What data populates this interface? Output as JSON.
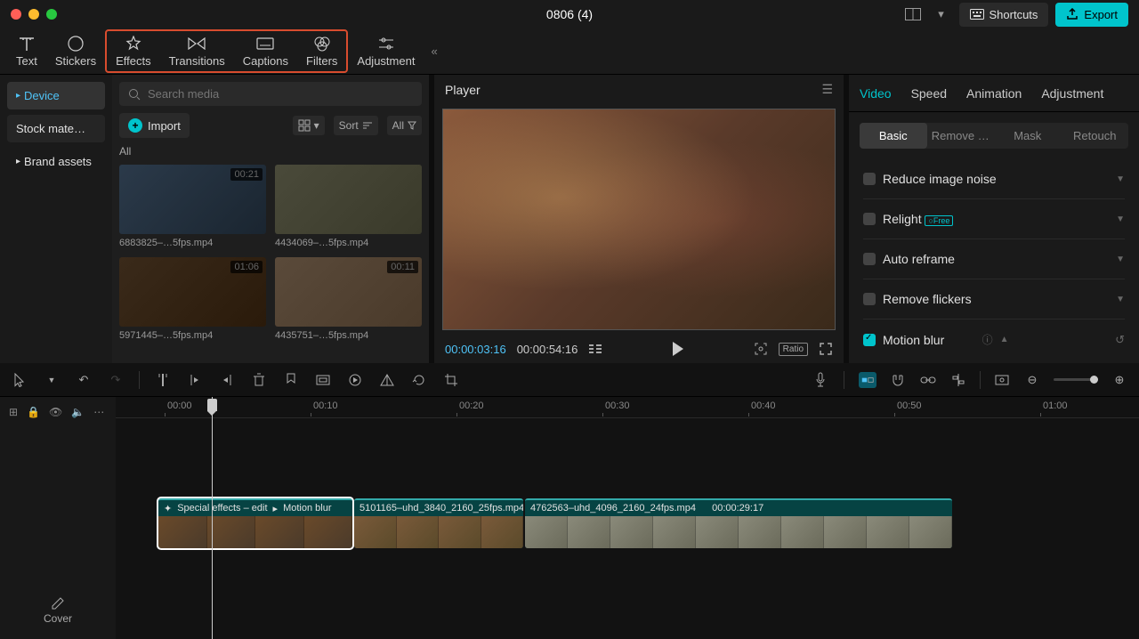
{
  "titlebar": {
    "title": "0806 (4)",
    "shortcuts": "Shortcuts",
    "export": "Export"
  },
  "topTabs": {
    "text": "Text",
    "stickers": "Stickers",
    "effects": "Effects",
    "transitions": "Transitions",
    "captions": "Captions",
    "filters": "Filters",
    "adjustment": "Adjustment"
  },
  "sidebar": {
    "device": "Device",
    "stock": "Stock mate…",
    "brand": "Brand assets"
  },
  "media": {
    "search_placeholder": "Search media",
    "import": "Import",
    "sort": "Sort",
    "all": "All",
    "section": "All",
    "items": [
      {
        "name": "6883825–…5fps.mp4",
        "duration": "00:21"
      },
      {
        "name": "4434069–…5fps.mp4",
        "duration": ""
      },
      {
        "name": "5971445–…5fps.mp4",
        "duration": "01:06"
      },
      {
        "name": "4435751–…5fps.mp4",
        "duration": "00:11"
      }
    ]
  },
  "player": {
    "title": "Player",
    "current": "00:00:03:16",
    "total": "00:00:54:16",
    "ratio": "Ratio"
  },
  "rightPanel": {
    "tabs": {
      "video": "Video",
      "speed": "Speed",
      "animation": "Animation",
      "adjustment": "Adjustment"
    },
    "subtabs": {
      "basic": "Basic",
      "remove": "Remove …",
      "mask": "Mask",
      "retouch": "Retouch"
    },
    "props": {
      "noise": "Reduce image noise",
      "relight": "Relight",
      "relight_badge": "○Free",
      "autoreframe": "Auto reframe",
      "flickers": "Remove flickers",
      "motionblur": "Motion blur"
    }
  },
  "timeline": {
    "cover": "Cover",
    "ticks": [
      "00:00",
      "00:10",
      "00:20",
      "00:30",
      "00:40",
      "00:50",
      "01:00"
    ],
    "clip1": {
      "label1": "Special effects – edit",
      "label2": "Motion blur"
    },
    "clip2": {
      "name": "5101165–uhd_3840_2160_25fps.mp4"
    },
    "clip3": {
      "name": "4762563–uhd_4096_2160_24fps.mp4",
      "time": "00:00:29:17"
    }
  }
}
